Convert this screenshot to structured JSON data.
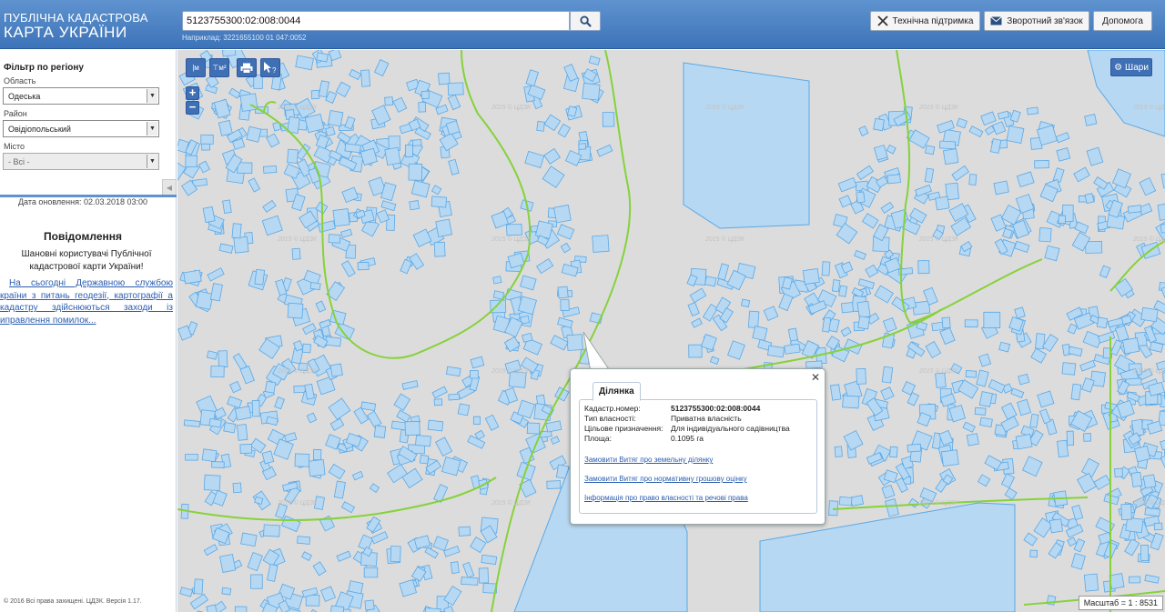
{
  "header": {
    "logo_line1": "ПУБЛІЧНА КАДАСТРОВА",
    "logo_line2": "КАРТА УКРАЇНИ",
    "search_value": "5123755300:02:008:0044",
    "search_hint": "Наприклад: 3221655100 01 047:0052",
    "btn_support": "Технічна підтримка",
    "btn_feedback": "Зворотний зв'язок",
    "btn_help": "Допомога"
  },
  "sidebar": {
    "filter_title": "Фільтр по регіону",
    "region_label": "Область",
    "region_value": "Одеська",
    "district_label": "Район",
    "district_value": "Овідіопольський",
    "city_label": "Місто",
    "city_value": "- Всі -",
    "update_date": "Дата оновлення: 02.03.2018 03:00",
    "notice_title": "Повідомлення",
    "notice_text": "Шановні користувачі Публічної кадастрової карти України!",
    "notice_link": "На сьогодні Державною службою країни з питань геодезії, картографії а кадастру здійснюються заходи із иправлення помилок...",
    "footer": "© 2016 Всі права захищені. ЦДЗК. Версія 1.17."
  },
  "map": {
    "tool_measure_length": "м",
    "tool_measure_area": "м²",
    "zoom_in": "+",
    "zoom_out": "−",
    "layers_label": "Шари",
    "scale_text": "Масштаб = 1 : 8531",
    "watermark": "2015 © ЦДЗК"
  },
  "popup": {
    "tab_label": "Ділянка",
    "rows": [
      {
        "label": "Кадастр.номер:",
        "value": "5123755300:02:008:0044"
      },
      {
        "label": "Тип власності:",
        "value": "Приватна власність"
      },
      {
        "label": "Цільове призначення:",
        "value": "Для індивідуального садівництва"
      },
      {
        "label": "Площа:",
        "value": "0.1095 га"
      }
    ],
    "link1": "Замовити Витяг про земельну ділянку",
    "link2": "Замовити Витяг про нормативну грошову оцінку",
    "link3": "Інформація про право власності та речові права"
  },
  "colors": {
    "header": "#4a80c4",
    "parcel_fill": "#b7d8f2",
    "parcel_stroke": "#5aa8e6",
    "boundary": "#86d23a",
    "map_bg": "#dcdcdc"
  }
}
